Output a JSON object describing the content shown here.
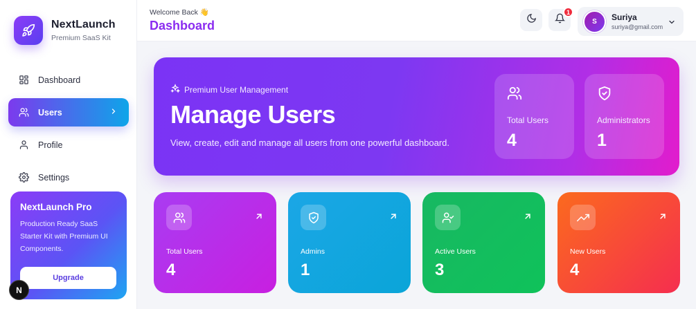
{
  "brand": {
    "name": "NextLaunch",
    "subtitle": "Premium SaaS Kit"
  },
  "nav": [
    {
      "label": "Dashboard",
      "icon": "grid-icon",
      "active": false
    },
    {
      "label": "Users",
      "icon": "users-icon",
      "active": true
    },
    {
      "label": "Profile",
      "icon": "user-icon",
      "active": false
    },
    {
      "label": "Settings",
      "icon": "gear-icon",
      "active": false
    }
  ],
  "pro_card": {
    "title": "NextLaunch Pro",
    "description": "Production Ready SaaS Starter Kit with Premium UI Components.",
    "button": "Upgrade"
  },
  "dev_badge": "N",
  "header": {
    "welcome": "Welcome Back 👋",
    "title": "Dashboard",
    "notifications": "1",
    "user": {
      "initial": "S",
      "name": "Suriya",
      "email": "suriya@gmail.com"
    }
  },
  "hero": {
    "tag": "Premium User Management",
    "title": "Manage Users",
    "description": "View, create, edit and manage all users from one powerful dashboard.",
    "stats": [
      {
        "label": "Total Users",
        "value": "4",
        "icon": "users-icon"
      },
      {
        "label": "Administrators",
        "value": "1",
        "icon": "shield-check-icon"
      }
    ]
  },
  "cards": [
    {
      "label": "Total Users",
      "value": "4",
      "icon": "users-icon",
      "gradient": [
        "#a93cf2",
        "#c81fe0"
      ]
    },
    {
      "label": "Admins",
      "value": "1",
      "icon": "shield-check-icon",
      "gradient": [
        "#1ba6e6",
        "#0aa5d8"
      ]
    },
    {
      "label": "Active Users",
      "value": "3",
      "icon": "user-check-icon",
      "gradient": [
        "#18b862",
        "#0fc25a"
      ]
    },
    {
      "label": "New Users",
      "value": "4",
      "icon": "trending-up-icon",
      "gradient": [
        "#fb6a1e",
        "#f52e4f"
      ]
    }
  ],
  "colors": {
    "accent": "#8b2cf0",
    "badge": "#ef2b3c"
  }
}
